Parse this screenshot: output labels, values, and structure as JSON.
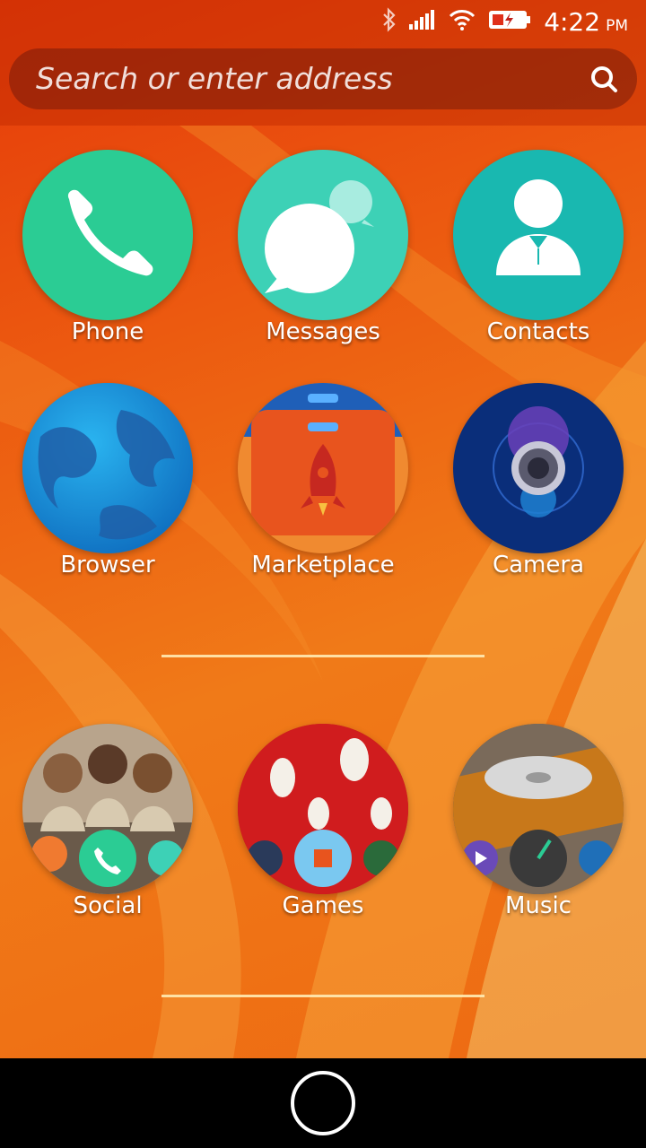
{
  "status_bar": {
    "time": "4:22",
    "ampm": "PM",
    "icons": [
      "bluetooth-icon",
      "signal-icon",
      "wifi-icon",
      "battery-icon"
    ]
  },
  "search": {
    "placeholder": "Search or enter address",
    "icon": "search-icon"
  },
  "apps": [
    {
      "label": "Phone",
      "icon": "phone-icon",
      "color": "#2bcc94"
    },
    {
      "label": "Messages",
      "icon": "messages-icon",
      "color": "#3dd1b6"
    },
    {
      "label": "Contacts",
      "icon": "contacts-icon",
      "color": "#19b8b0"
    },
    {
      "label": "Browser",
      "icon": "browser-globe-icon",
      "color": "#1a8fd8"
    },
    {
      "label": "Marketplace",
      "icon": "marketplace-rocket-icon",
      "color": "#e8541e"
    },
    {
      "label": "Camera",
      "icon": "camera-icon",
      "color": "#0a2e7a"
    }
  ],
  "collections": [
    {
      "label": "Social",
      "icon": "social-collection-icon"
    },
    {
      "label": "Games",
      "icon": "games-collection-icon"
    },
    {
      "label": "Music",
      "icon": "music-collection-icon"
    }
  ],
  "nav": {
    "home_icon": "home-button-icon"
  }
}
